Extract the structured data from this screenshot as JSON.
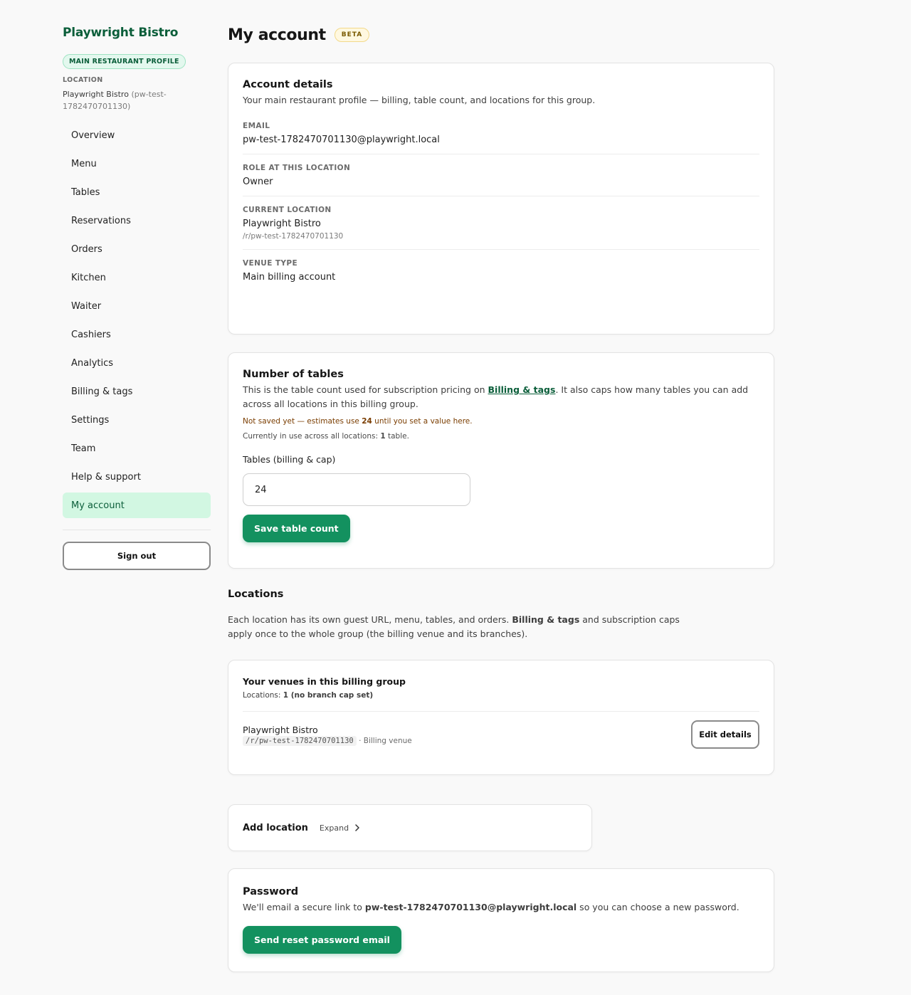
{
  "sidebar": {
    "brand": "Playwright Bistro",
    "profile_badge": "MAIN RESTAURANT PROFILE",
    "location_label": "LOCATION",
    "location_name": "Playwright Bistro",
    "location_slug_line1": "(pw-test-",
    "location_slug_line2": "1782470701130)",
    "nav": [
      {
        "label": "Overview"
      },
      {
        "label": "Menu"
      },
      {
        "label": "Tables"
      },
      {
        "label": "Reservations"
      },
      {
        "label": "Orders"
      },
      {
        "label": "Kitchen"
      },
      {
        "label": "Waiter"
      },
      {
        "label": "Cashiers"
      },
      {
        "label": "Analytics"
      },
      {
        "label": "Billing & tags"
      },
      {
        "label": "Settings"
      },
      {
        "label": "Team"
      },
      {
        "label": "Help & support"
      },
      {
        "label": "My account",
        "active": true
      }
    ],
    "sign_out": "Sign out"
  },
  "header": {
    "title": "My account",
    "badge": "BETA"
  },
  "account_details": {
    "title": "Account details",
    "subtitle": "Your main restaurant profile — billing, table count, and locations for this group.",
    "email_label": "EMAIL",
    "email_value": "pw-test-1782470701130@playwright.local",
    "role_label": "ROLE AT THIS LOCATION",
    "role_value": "Owner",
    "current_location_label": "CURRENT LOCATION",
    "current_location_value": "Playwright Bistro",
    "current_location_path": "/r/pw-test-1782470701130",
    "venue_type_label": "VENUE TYPE",
    "venue_type_value": "Main billing account"
  },
  "tables": {
    "title": "Number of tables",
    "desc_before": "This is the table count used for subscription pricing on ",
    "desc_link": "Billing & tags",
    "desc_after": ". It also caps how many tables you can add across all locations in this billing group.",
    "warn_before": "Not saved yet — estimates use ",
    "warn_value": "24",
    "warn_after": " until you set a value here.",
    "usage_before": "Currently in use across all locations: ",
    "usage_value": "1",
    "usage_after": " table.",
    "input_label": "Tables (billing & cap)",
    "input_value": "24",
    "save_button": "Save table count"
  },
  "locations": {
    "title": "Locations",
    "desc_before": "Each location has its own guest URL, menu, tables, and orders. ",
    "desc_bold": "Billing & tags",
    "desc_after": " and subscription caps apply once to the whole group (the billing venue and its branches).",
    "group_title": "Your venues in this billing group",
    "count_label": "Locations: ",
    "count_value": "1 (no branch cap set)",
    "venue_name": "Playwright Bistro",
    "venue_path": "/r/pw-test-1782470701130",
    "venue_type": "· Billing venue",
    "edit_button": "Edit details"
  },
  "add_location": {
    "title": "Add location",
    "expand": "Expand"
  },
  "password": {
    "title": "Password",
    "desc_before": "We'll email a secure link to ",
    "desc_email": "pw-test-1782470701130@playwright.local",
    "desc_after": " so you can choose a new password.",
    "button": "Send reset password email"
  },
  "colors": {
    "brand_green": "#0b5e3a",
    "primary_button": "#13915f",
    "active_nav_bg": "#d2f7e2",
    "beta_bg": "#fff8e0"
  }
}
